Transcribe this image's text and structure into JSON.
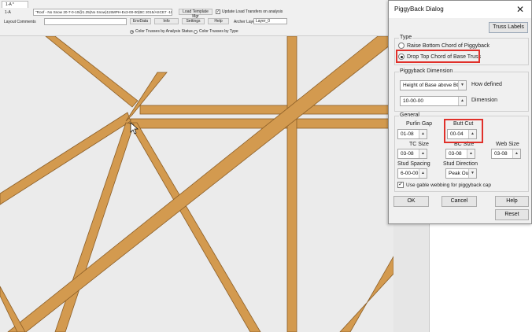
{
  "app": {
    "doc_tab": "1-A *",
    "layout_id": "1-A",
    "roof_description": "\"Roof - No Snow 20-7-0-10@1.25(No Snow)115MPH-Ex3-00-00(BC 2015/ASCE7 -10)TPI 2",
    "load_template_btn": "Load Template Mgr",
    "update_load_label": "Update Load Transfers on analysis",
    "layout_comments_label": "Layout Comments",
    "envdata_btn": "EnvData",
    "info_btn": "Info",
    "settings_btn": "Settings",
    "help_btn": "Help",
    "archer_layer_label": "Archer Layer",
    "archer_layer_value": "Layer_0",
    "radio_color_analysis": "Color Trusses by Analysis Status",
    "radio_color_type": "Color Trusses by Type"
  },
  "dialog": {
    "title": "PiggyBack Dialog",
    "close_glyph": "✕",
    "truss_labels_btn": "Truss Labels",
    "type_group": {
      "title": "Type",
      "options": [
        {
          "label": "Raise Bottom Chord of Piggyback",
          "selected": false
        },
        {
          "label": "Drop Top Chord of Base Truss",
          "selected": true
        }
      ]
    },
    "piggyback_group": {
      "title": "Piggyback Dimension",
      "how_defined_value": "Height of Base above BC",
      "how_defined_label": "How defined",
      "dimension_value": "10-00-00",
      "dimension_label": "Dimension"
    },
    "general_group": {
      "title": "General",
      "purlin_gap_label": "Purlin Gap",
      "purlin_gap_value": "01-08",
      "butt_cut_label": "Butt Cut",
      "butt_cut_value": "00-04",
      "tc_size_label": "TC Size",
      "tc_size_value": "03-08",
      "bc_size_label": "BC Size",
      "bc_size_value": "03-08",
      "web_size_label": "Web Size",
      "web_size_value": "03-08",
      "stud_spacing_label": "Stud Spacing",
      "stud_spacing_value": "6-00-00",
      "stud_direction_label": "Stud Direction",
      "stud_direction_value": "Peak Out",
      "gable_webbing_label": "Use gable webbing for piggyback cap",
      "gable_webbing_checked": true
    },
    "ok_btn": "OK",
    "cancel_btn": "Cancel",
    "help_btn": "Help",
    "reset_btn": "Reset"
  },
  "colors": {
    "timber": "#d39a4f",
    "timber_edge": "#8b5e27",
    "highlight": "#e0302a",
    "canvas_bg": "#ebebeb"
  },
  "icons": {
    "cursor": "mouse-pointer-icon",
    "dropdown": "chevron-down-icon",
    "spinner": "chevron-up-icon"
  }
}
